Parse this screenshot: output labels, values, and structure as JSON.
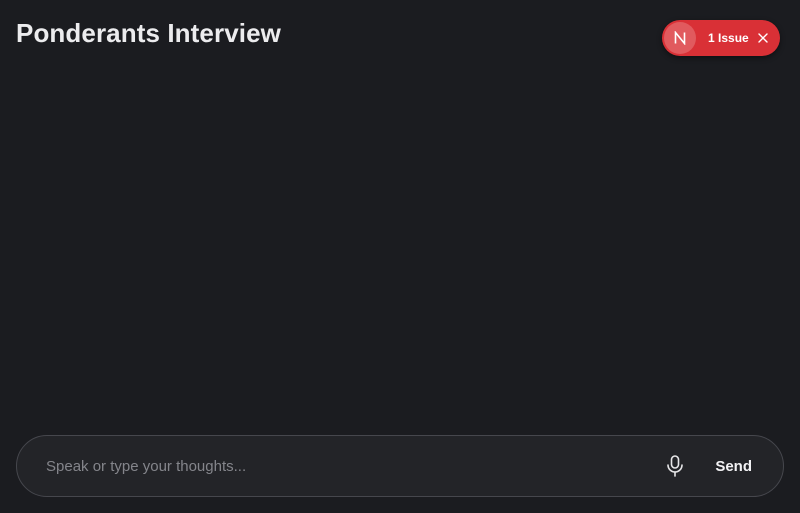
{
  "header": {
    "title": "Ponderants Interview"
  },
  "dev_indicator": {
    "badge_letter": "N",
    "issue_label": "1 Issue",
    "close_icon": "close-icon",
    "color": "#d93036"
  },
  "composer": {
    "placeholder": "Speak or type your thoughts...",
    "value": "",
    "mic_icon": "microphone-icon",
    "send_label": "Send"
  }
}
